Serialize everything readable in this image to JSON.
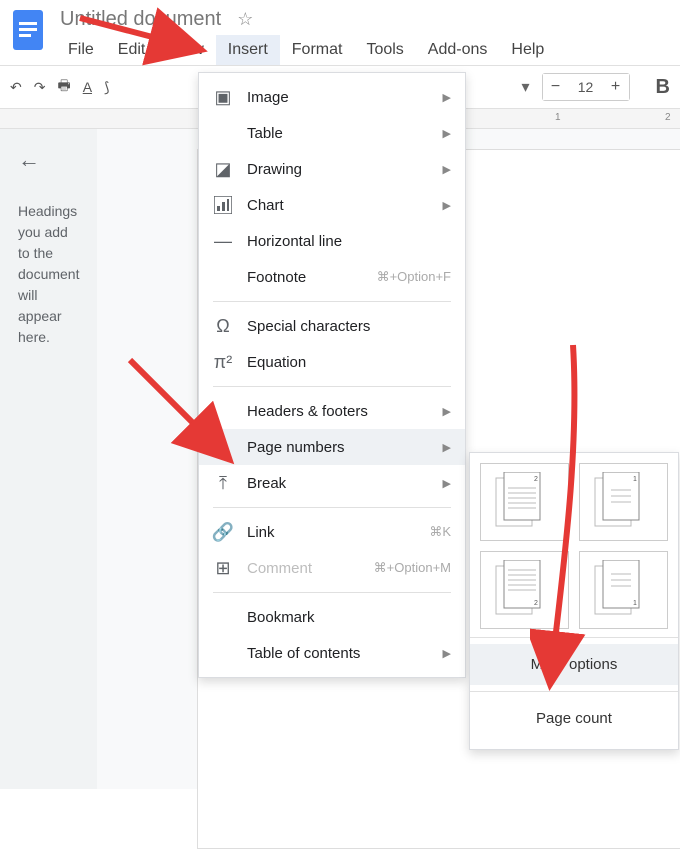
{
  "doc_title": "Untitled document",
  "menubar": {
    "file": "File",
    "edit": "Edit",
    "view": "View",
    "insert": "Insert",
    "format": "Format",
    "tools": "Tools",
    "addons": "Add-ons",
    "help": "Help"
  },
  "toolbar": {
    "font_size": "12"
  },
  "ruler": {
    "t1": "1",
    "t2": "2"
  },
  "sidebar": {
    "outline_text": "Headings you add to the document will appear here."
  },
  "insert_menu": {
    "image": "Image",
    "table": "Table",
    "drawing": "Drawing",
    "chart": "Chart",
    "hrule": "Horizontal line",
    "footnote": "Footnote",
    "footnote_sc": "⌘+Option+F",
    "special": "Special characters",
    "equation": "Equation",
    "headers": "Headers & footers",
    "pagenums": "Page numbers",
    "break": "Break",
    "link": "Link",
    "link_sc": "⌘K",
    "comment": "Comment",
    "comment_sc": "⌘+Option+M",
    "bookmark": "Bookmark",
    "toc": "Table of contents"
  },
  "submenu": {
    "more_options": "More options",
    "page_count": "Page count"
  }
}
